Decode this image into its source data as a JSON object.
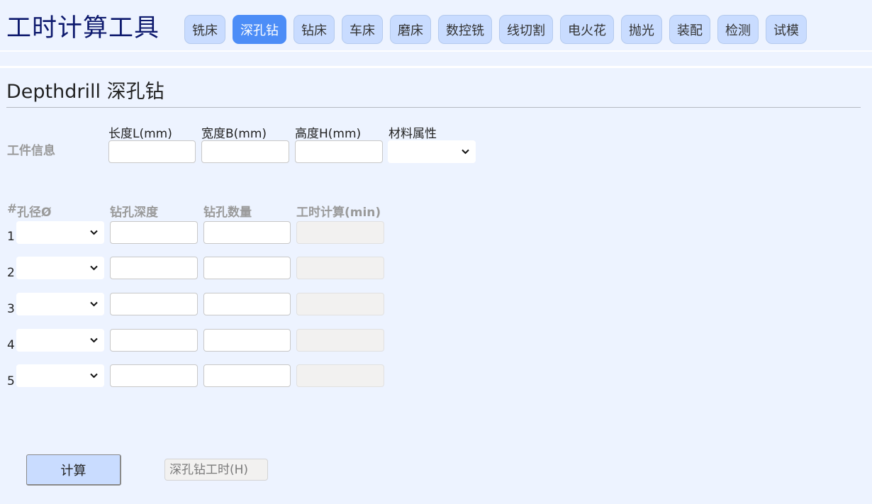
{
  "app": {
    "title": "工时计算工具"
  },
  "nav": {
    "tabs": [
      {
        "label": "铣床"
      },
      {
        "label": "深孔钻",
        "active": true
      },
      {
        "label": "钻床"
      },
      {
        "label": "车床"
      },
      {
        "label": "磨床"
      },
      {
        "label": "数控铣"
      },
      {
        "label": "线切割"
      },
      {
        "label": "电火花"
      },
      {
        "label": "抛光"
      },
      {
        "label": "装配"
      },
      {
        "label": "检测"
      },
      {
        "label": "试模"
      }
    ],
    "active_color": "#4c8df7",
    "tab_color": "#c9dcff"
  },
  "section": {
    "title": "Depthdrill 深孔钻"
  },
  "workpiece": {
    "label": "工件信息",
    "length_label": "长度L(mm)",
    "length_value": "",
    "width_label": "宽度B(mm)",
    "width_value": "",
    "height_label": "高度H(mm)",
    "height_value": "",
    "material_label": "材料属性",
    "material_value": ""
  },
  "holes": {
    "headers": {
      "hash": "#",
      "diameter": "孔径Ø",
      "depth": "钻孔深度",
      "count": "钻孔数量",
      "time": "工时计算(min)"
    },
    "rows": [
      {
        "num": "1",
        "diameter": "",
        "depth": "",
        "count": "",
        "time": ""
      },
      {
        "num": "2",
        "diameter": "",
        "depth": "",
        "count": "",
        "time": ""
      },
      {
        "num": "3",
        "diameter": "",
        "depth": "",
        "count": "",
        "time": ""
      },
      {
        "num": "4",
        "diameter": "",
        "depth": "",
        "count": "",
        "time": ""
      },
      {
        "num": "5",
        "diameter": "",
        "depth": "",
        "count": "",
        "time": ""
      }
    ]
  },
  "actions": {
    "calculate_label": "计算",
    "result_placeholder": "深孔钻工时(H)",
    "result_value": ""
  },
  "icons": {
    "select_arrow": "chevron-down-icon"
  }
}
